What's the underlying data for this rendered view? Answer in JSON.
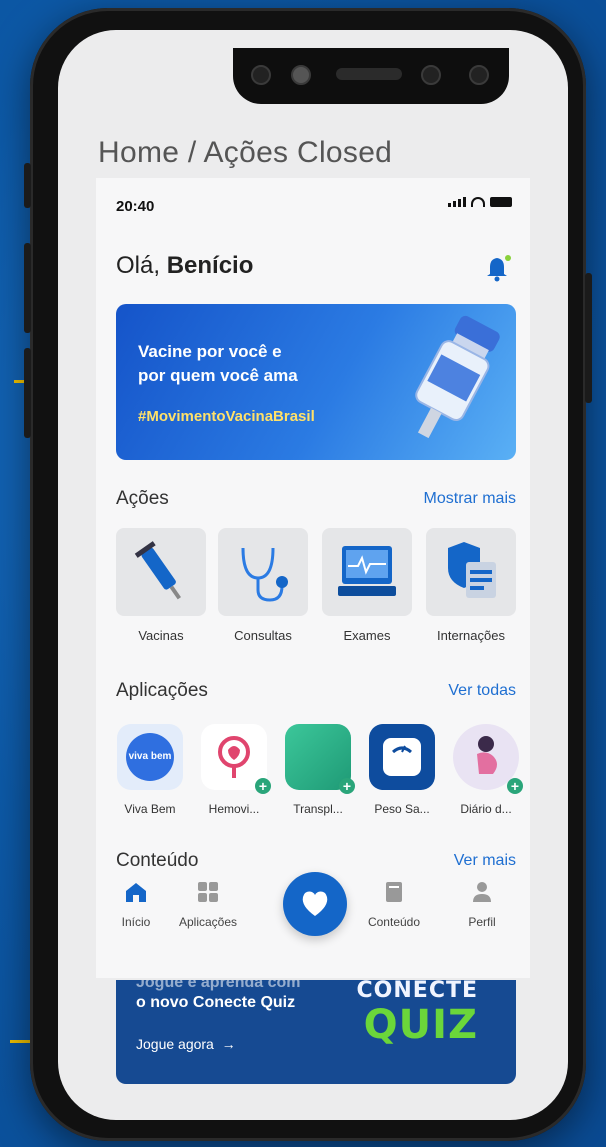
{
  "page_title": "Home / Ações Closed",
  "status_bar": {
    "time": "20:40"
  },
  "greeting": {
    "hello": "Olá,",
    "name": "Benício"
  },
  "banner": {
    "line1": "Vacine por você e",
    "line2": "por quem você ama",
    "hashtag": "#MovimentoVacinaBrasil"
  },
  "actions": {
    "title": "Ações",
    "more_link": "Mostrar mais",
    "items": [
      {
        "label": "Vacinas",
        "icon": "syringe-icon"
      },
      {
        "label": "Consultas",
        "icon": "stethoscope-icon"
      },
      {
        "label": "Exames",
        "icon": "monitor-icon"
      },
      {
        "label": "Internações",
        "icon": "shield-document-icon"
      }
    ]
  },
  "apps": {
    "title": "Aplicações",
    "more_link": "Ver todas",
    "items": [
      {
        "label": "Viva Bem",
        "icon_text": "viva bem"
      },
      {
        "label": "Hemovi..."
      },
      {
        "label": "Transpl..."
      },
      {
        "label": "Peso Sa..."
      },
      {
        "label": "Diário d..."
      }
    ]
  },
  "content": {
    "title": "Conteúdo",
    "more_link": "Ver mais"
  },
  "nav": {
    "items": [
      {
        "label": "Início"
      },
      {
        "label": "Aplicações"
      },
      {
        "label": "Conteúdo"
      },
      {
        "label": "Perfil"
      }
    ]
  },
  "quiz": {
    "line1": "Jogue e aprenda com",
    "line2": "o novo Conecte Quiz",
    "cta": "Jogue agora",
    "brand_top": "CONECTE",
    "brand_bottom": "QUIZ"
  },
  "colors": {
    "background": "#0d5aa8",
    "accent_yellow": "#f2c200",
    "primary_blue": "#1466c8",
    "link_blue": "#1f6fd1"
  }
}
